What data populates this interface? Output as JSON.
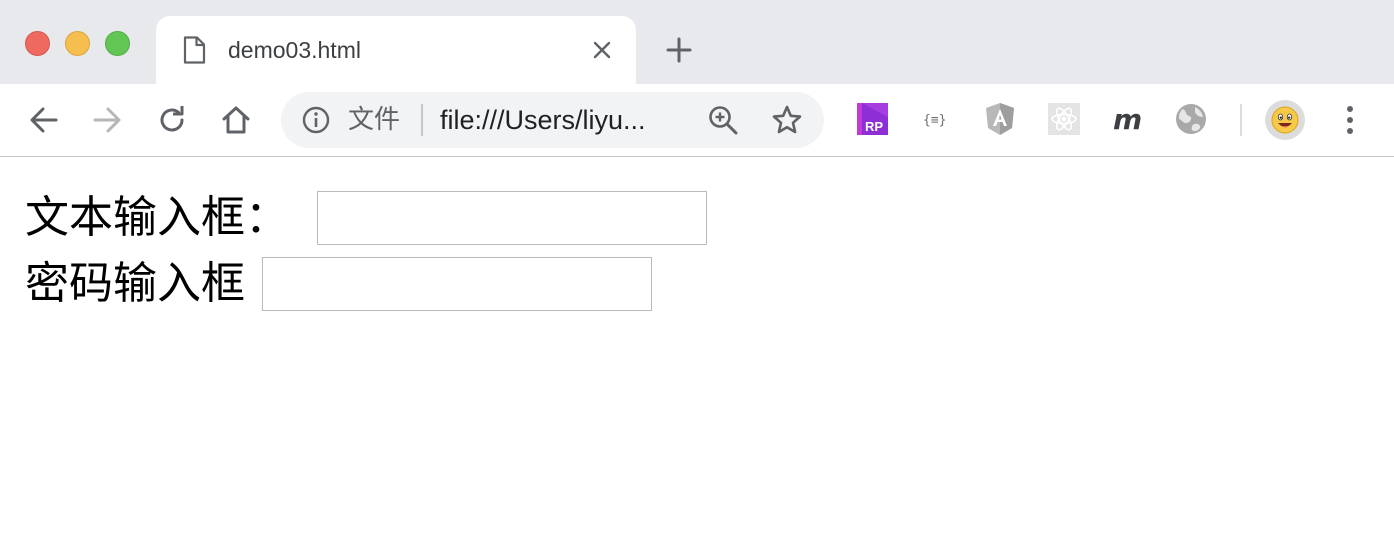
{
  "window": {
    "controls": [
      "close",
      "minimize",
      "maximize"
    ]
  },
  "tab": {
    "title": "demo03.html",
    "icon": "document-icon"
  },
  "toolbar": {
    "back_icon": "arrow-left-icon",
    "forward_icon": "arrow-right-icon",
    "reload_icon": "reload-icon",
    "home_icon": "home-icon",
    "security_label": "文件",
    "url": "file:///Users/liyu...",
    "extensions": [
      "axure-rp-icon",
      "json-formatter-icon",
      "angular-icon",
      "react-devtools-icon",
      "m-extension-icon",
      "globe-icon"
    ],
    "profile_avatar": "emoji-face-icon"
  },
  "page": {
    "text_label": "文本输入框：",
    "text_value": "",
    "password_label": "密码输入框",
    "password_value": ""
  },
  "colors": {
    "tabstrip_bg": "#e8e9ed",
    "omnibox_bg": "#f1f3f4",
    "traffic_red": "#ee6a5f",
    "traffic_yellow": "#f5be4f",
    "traffic_green": "#62c655",
    "axure_purple": "#8e2fd6"
  }
}
